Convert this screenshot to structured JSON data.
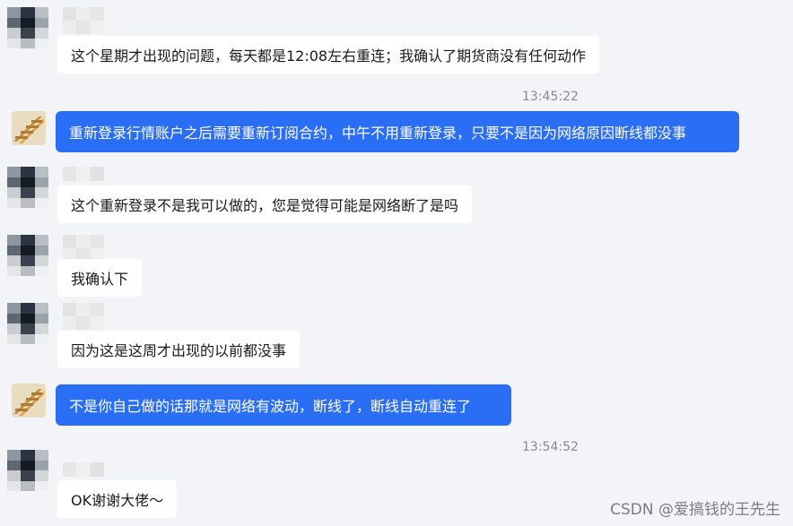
{
  "chat": {
    "messages": [
      {
        "side": "in",
        "text": "这个星期才出现的问题，每天都是12:08左右重连；我确认了期货商没有任何动作"
      },
      {
        "side": "out",
        "text": "重新登录行情账户之后需要重新订阅合约，中午不用重新登录，只要不是因为网络原因断线都没事"
      },
      {
        "side": "in",
        "text": "这个重新登录不是我可以做的，您是觉得可能是网络断了是吗"
      },
      {
        "side": "in",
        "text": "我确认下"
      },
      {
        "side": "in",
        "text": "因为这是这周才出现的以前都没事"
      },
      {
        "side": "out",
        "text": "不是你自己做的话那就是网络有波动，断线了，断线自动重连了"
      },
      {
        "side": "in",
        "text": "OK谢谢大佬～"
      }
    ],
    "timestamps": [
      "13:45:22",
      "13:54:52"
    ]
  },
  "watermark": "CSDN @爱搞钱的王先生",
  "colors": {
    "background": "#f3f4f7",
    "outgoing_bubble": "#2b6ef6",
    "incoming_bubble": "#ffffff",
    "timestamp": "#8a8a8a"
  }
}
